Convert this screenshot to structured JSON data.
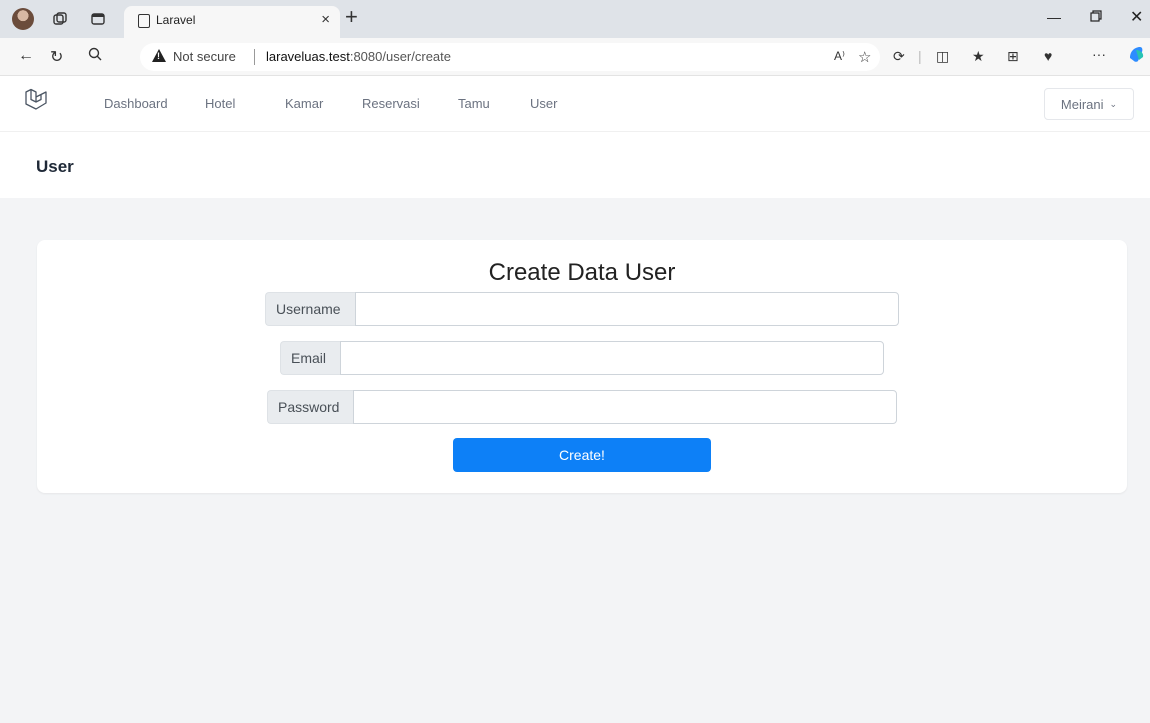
{
  "browser": {
    "tab_title": "Laravel",
    "tab_close": "×",
    "new_tab": "+",
    "not_secure": "Not secure",
    "url_host": "laraveluas.test",
    "url_path": ":8080/user/create",
    "read_aloud": "A⁾",
    "more": "···"
  },
  "nav": {
    "links": [
      "Dashboard",
      "Hotel",
      "Kamar",
      "Reservasi",
      "Tamu",
      "User"
    ],
    "user_menu": "Meirani"
  },
  "page": {
    "header": "User"
  },
  "form": {
    "title": "Create Data User",
    "username_label": "Username",
    "email_label": "Email",
    "password_label": "Password",
    "username_value": "",
    "email_value": "",
    "password_value": "",
    "submit_label": "Create!"
  },
  "colors": {
    "primary_button": "#0d80f7",
    "background": "#f3f4f6"
  }
}
